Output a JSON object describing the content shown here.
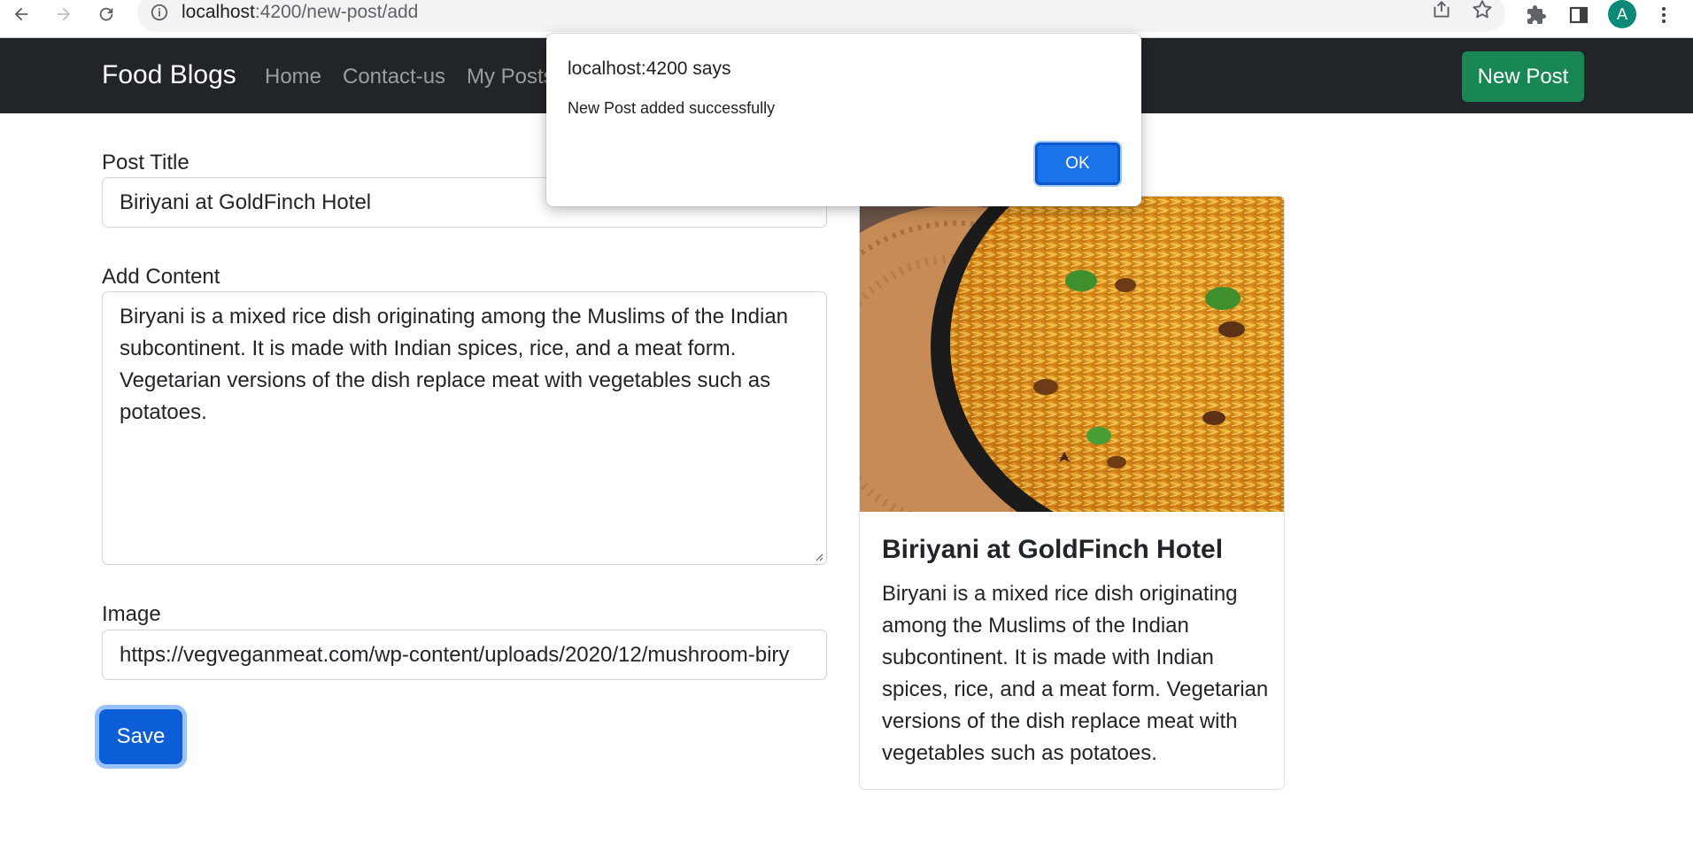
{
  "browser": {
    "url_host": "localhost",
    "url_rest": ":4200/new-post/add",
    "profile_initial": "A",
    "icons": [
      "back-icon",
      "forward-icon",
      "reload-icon",
      "site-info-icon",
      "share-icon",
      "bookmark-star-icon",
      "extensions-icon",
      "side-panel-icon",
      "menu-kebab-icon"
    ]
  },
  "navbar": {
    "brand": "Food Blogs",
    "links": [
      "Home",
      "Contact-us",
      "My Posts"
    ],
    "new_post_label": "New Post",
    "new_post_color": "#198754"
  },
  "form": {
    "title_label": "Post Title",
    "title_value": "Biriyani at GoldFinch Hotel",
    "content_label": "Add Content",
    "content_value": "Biryani is a mixed rice dish originating among the Muslims of the Indian subcontinent. It is made with Indian spices, rice, and a meat form. Vegetarian versions of the dish replace meat with vegetables such as potatoes.",
    "image_label": "Image",
    "image_value": "https://vegveganmeat.com/wp-content/uploads/2020/12/mushroom-biry",
    "save_label": "Save"
  },
  "preview_card": {
    "title": "Biriyani at GoldFinch Hotel",
    "text": "Biryani is a mixed rice dish originating among the Muslims of the Indian subcontinent. It is made with Indian spices, rice, and a meat form. Vegetarian versions of the dish replace meat with vegetables such as potatoes."
  },
  "dialog": {
    "origin": "localhost:4200 says",
    "message": "New Post added successfully",
    "ok_label": "OK",
    "accent_color": "#1a73e8"
  }
}
